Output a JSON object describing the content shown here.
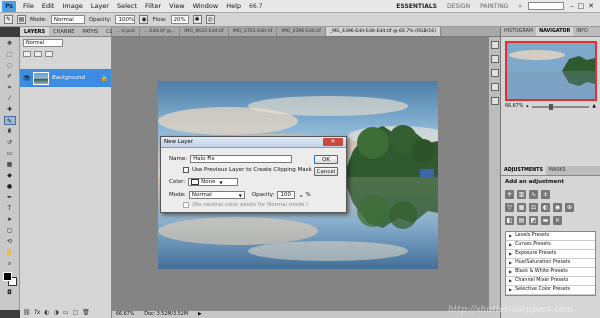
{
  "app": {
    "logo": "Ps"
  },
  "menubar": {
    "items": [
      "File",
      "Edit",
      "Image",
      "Layer",
      "Select",
      "Filter",
      "View",
      "Window",
      "Help"
    ],
    "zoom": "66.7",
    "workspaces": [
      "ESSENTIALS",
      "DESIGN",
      "PAINTING"
    ],
    "more": "»",
    "win_controls": [
      "–",
      "□",
      "✕"
    ]
  },
  "options": {
    "mode_label": "Mode:",
    "mode_value": "Normal",
    "opacity_label": "Opacity:",
    "opacity_value": "100%",
    "flow_label": "Flow:",
    "flow_value": "20%"
  },
  "layers_panel": {
    "tabs": [
      "LAYERS",
      "CHANNE",
      "PATHS",
      "CLONES",
      "»"
    ],
    "blend_mode": "Normal",
    "layer_name": "Background"
  },
  "doc_tabs": [
    "...-0.psd",
    "...-Edit.tif @...",
    "IMG_9622-Edit.tif",
    "IMG_0762-Edit.tif",
    "IMG_4396-Edit.tif",
    "_MG_4396-Edit-Edit-Edit.tif @ 66.7% (RGB/16)"
  ],
  "status": {
    "zoom": "66.67%",
    "doc": "Doc: 3.52M/3.52M"
  },
  "navigator": {
    "tabs": [
      "HISTOGRAM",
      "NAVIGATOR",
      "INFO"
    ],
    "zoom": "66.67%"
  },
  "adjustments": {
    "tabs": [
      "ADJUSTMENTS",
      "MASKS"
    ],
    "title": "Add an adjustment",
    "presets": [
      "Levels Presets",
      "Curves Presets",
      "Exposure Presets",
      "Hue/Saturation Presets",
      "Black & White Presets",
      "Channel Mixer Presets",
      "Selective Color Presets"
    ]
  },
  "dialog": {
    "title": "New Layer",
    "close": "✕",
    "name_label": "Name:",
    "name_value": "Halo Fix",
    "clip_label": "Use Previous Layer to Create Clipping Mask",
    "color_label": "Color:",
    "color_value": "None",
    "mode_label": "Mode:",
    "mode_value": "Normal",
    "opacity_label": "Opacity:",
    "opacity_value": "100",
    "percent": "%",
    "neutral_label": "(No neutral color exists for Normal mode.)",
    "ok": "OK",
    "cancel": "Cancel"
  },
  "watermark": "http://shutter-steppers.com",
  "colors": {
    "selection": "#3c8ce2",
    "nav_border": "#e03030"
  }
}
